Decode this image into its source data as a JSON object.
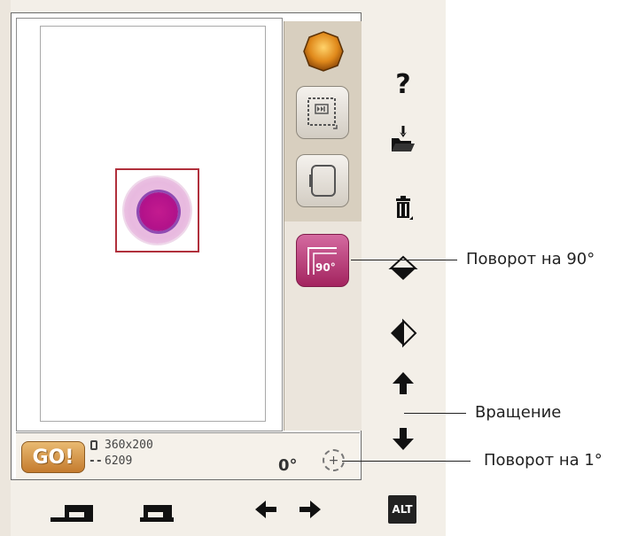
{
  "status_bar": {
    "go_label": "GO!",
    "hoop_size": "360x200",
    "stitch_count": "6209",
    "stitch_prefix": "--",
    "angle": "0°"
  },
  "bottom_bar": {
    "alt_label": "ALT"
  },
  "callouts": {
    "rotate_90": "Поворот на 90°",
    "rotation": "Вращение",
    "rotate_1": "Поворот на 1°"
  },
  "rotate_button_label": "90°",
  "help_icon_text": "?",
  "colors": {
    "active_button": "#b2376f",
    "design_frame": "#b0303c",
    "flower_center": "#c31b8f",
    "go_button": "#d89b4e"
  },
  "icons": [
    "color-gem-icon",
    "stitch-out-icon",
    "hoop-icon",
    "rotate-90-icon",
    "help-icon",
    "open-folder-icon",
    "delete-icon",
    "mirror-vertical-icon",
    "mirror-horizontal-icon",
    "arrow-up-icon",
    "arrow-down-icon",
    "machine-icon",
    "arrow-left-icon",
    "arrow-right-icon"
  ]
}
